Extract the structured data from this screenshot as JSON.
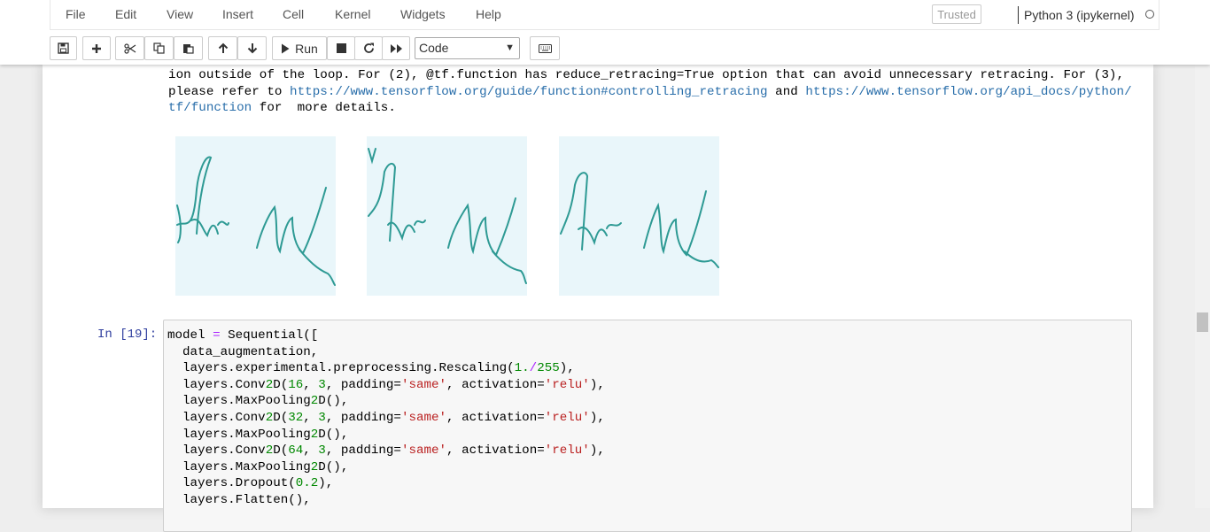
{
  "menu": [
    "File",
    "Edit",
    "View",
    "Insert",
    "Cell",
    "Kernel",
    "Widgets",
    "Help"
  ],
  "trusted_label": "Trusted",
  "kernel_label": "Python 3 (ipykernel)",
  "toolbar": {
    "run_label": "Run",
    "cell_type": "Code"
  },
  "markdown": {
    "line1_prefix": "ion outside of the loop. For (2), @tf.function has reduce_retracing=True option that can avoid unnecessary retracing. For (3),",
    "line2_prefix": "please refer to ",
    "link1": "https://www.tensorflow.org/guide/function#controlling_retracing",
    "line2_mid": " and ",
    "link2a": "https://www.tensorflow.org/api_docs/python/",
    "link2b": "tf/function",
    "line3_suffix": " for  more details."
  },
  "thumbnails": [
    "signature-image-1",
    "signature-image-2",
    "signature-image-3"
  ],
  "cell": {
    "prompt": "In [19]:",
    "code": [
      "model = Sequential([",
      "  data_augmentation,",
      "  layers.experimental.preprocessing.Rescaling(1./255),",
      "  layers.Conv2D(16, 3, padding='same', activation='relu'),",
      "  layers.MaxPooling2D(),",
      "  layers.Conv2D(32, 3, padding='same', activation='relu'),",
      "  layers.MaxPooling2D(),",
      "  layers.Conv2D(64, 3, padding='same', activation='relu'),",
      "  layers.MaxPooling2D(),",
      "  layers.Dropout(0.2),",
      "  layers.Flatten(),"
    ]
  },
  "colors": {
    "link": "#296eaa",
    "prompt": "#303f9f",
    "number": "#008800",
    "string": "#ba2121",
    "operator": "#aa22ff"
  }
}
